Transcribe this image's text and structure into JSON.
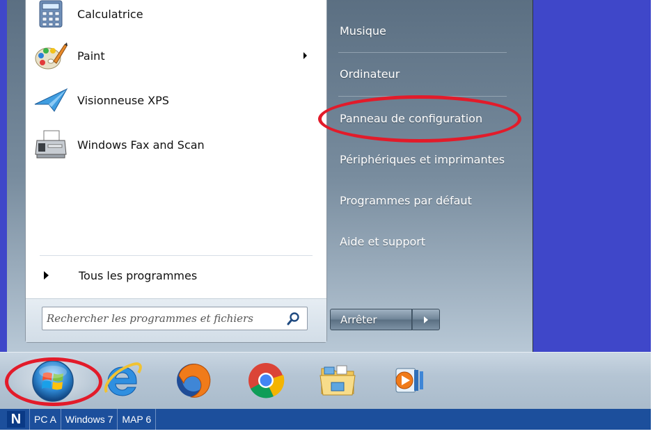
{
  "start_menu": {
    "programs": [
      {
        "label": "Calculatrice",
        "icon": "calculator-icon",
        "has_submenu": false
      },
      {
        "label": "Paint",
        "icon": "paint-palette-icon",
        "has_submenu": true
      },
      {
        "label": "Visionneuse XPS",
        "icon": "xps-viewer-icon",
        "has_submenu": false
      },
      {
        "label": "Windows Fax and Scan",
        "icon": "fax-scanner-icon",
        "has_submenu": false
      }
    ],
    "all_programs_label": "Tous les programmes",
    "search": {
      "placeholder": "Rechercher les programmes et fichiers"
    },
    "right_items": [
      {
        "label": "Musique"
      },
      {
        "label": "Ordinateur"
      },
      {
        "label": "Panneau de configuration",
        "highlighted": true
      },
      {
        "label": "Périphériques et imprimantes"
      },
      {
        "label": "Programmes par défaut"
      },
      {
        "label": "Aide et support"
      }
    ],
    "shutdown_label": "Arrêter"
  },
  "taskbar": {
    "pinned": [
      "windows-start-orb",
      "internet-explorer-icon",
      "firefox-icon",
      "chrome-icon",
      "file-explorer-icon",
      "media-player-icon"
    ]
  },
  "bottom_toolbar": {
    "badge": "N",
    "items": [
      "PC A",
      "Windows 7",
      "MAP 6"
    ]
  },
  "colors": {
    "desktop": "#3f47c9",
    "highlight_ring": "#e21b2a",
    "toolbar": "#1c4f9c"
  }
}
